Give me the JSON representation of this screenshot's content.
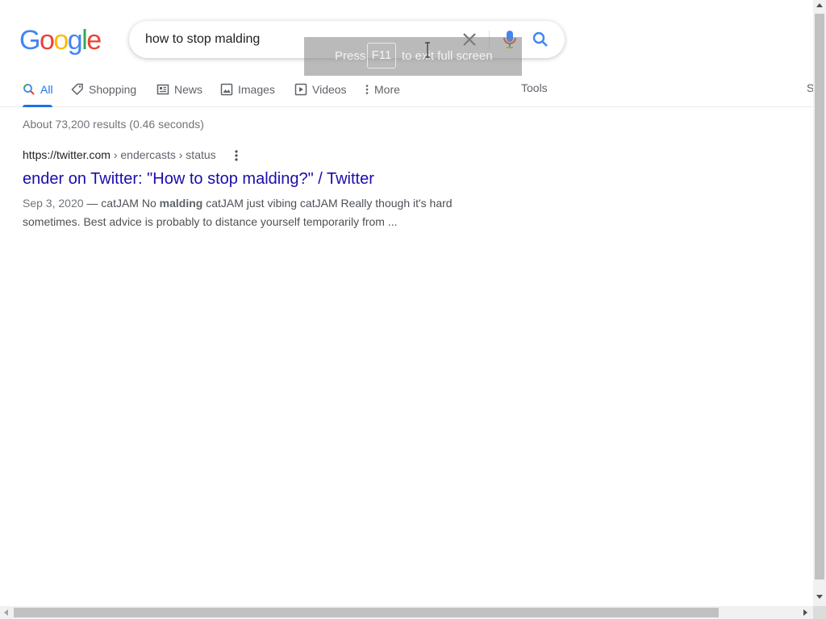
{
  "logo": {
    "letters": [
      "G",
      "o",
      "o",
      "g",
      "l",
      "e"
    ]
  },
  "colors": {
    "blue": "#4285f4",
    "red": "#ea4335",
    "yellow": "#fbbc05",
    "green": "#34a853",
    "link": "#1a0dab",
    "active_tab": "#1a73e8"
  },
  "search": {
    "query": "how to stop malding"
  },
  "fullscreen_toast": {
    "press": "Press",
    "key": "F11",
    "rest": "to exit full screen"
  },
  "tabs": [
    {
      "label": "All",
      "icon": "search-icon",
      "active": true
    },
    {
      "label": "Shopping",
      "icon": "tag-icon"
    },
    {
      "label": "News",
      "icon": "news-icon"
    },
    {
      "label": "Images",
      "icon": "image-icon"
    },
    {
      "label": "Videos",
      "icon": "play-icon"
    },
    {
      "label": "More",
      "icon": "more-vert-icon"
    }
  ],
  "tools_label": "Tools",
  "safe_label": "S",
  "stats": "About 73,200 results (0.46 seconds)",
  "result": {
    "cite_domain": "https://twitter.com",
    "cite_path": " › endercasts › status",
    "title": "ender on Twitter: \"How to stop malding?\" / Twitter",
    "date": "Sep 3, 2020",
    "dash": " — ",
    "snippet_pre": "catJAM No ",
    "snippet_bold": "malding",
    "snippet_post": " catJAM just vibing catJAM Really though it's hard sometimes. Best advice is probably to distance yourself temporarily from ..."
  }
}
